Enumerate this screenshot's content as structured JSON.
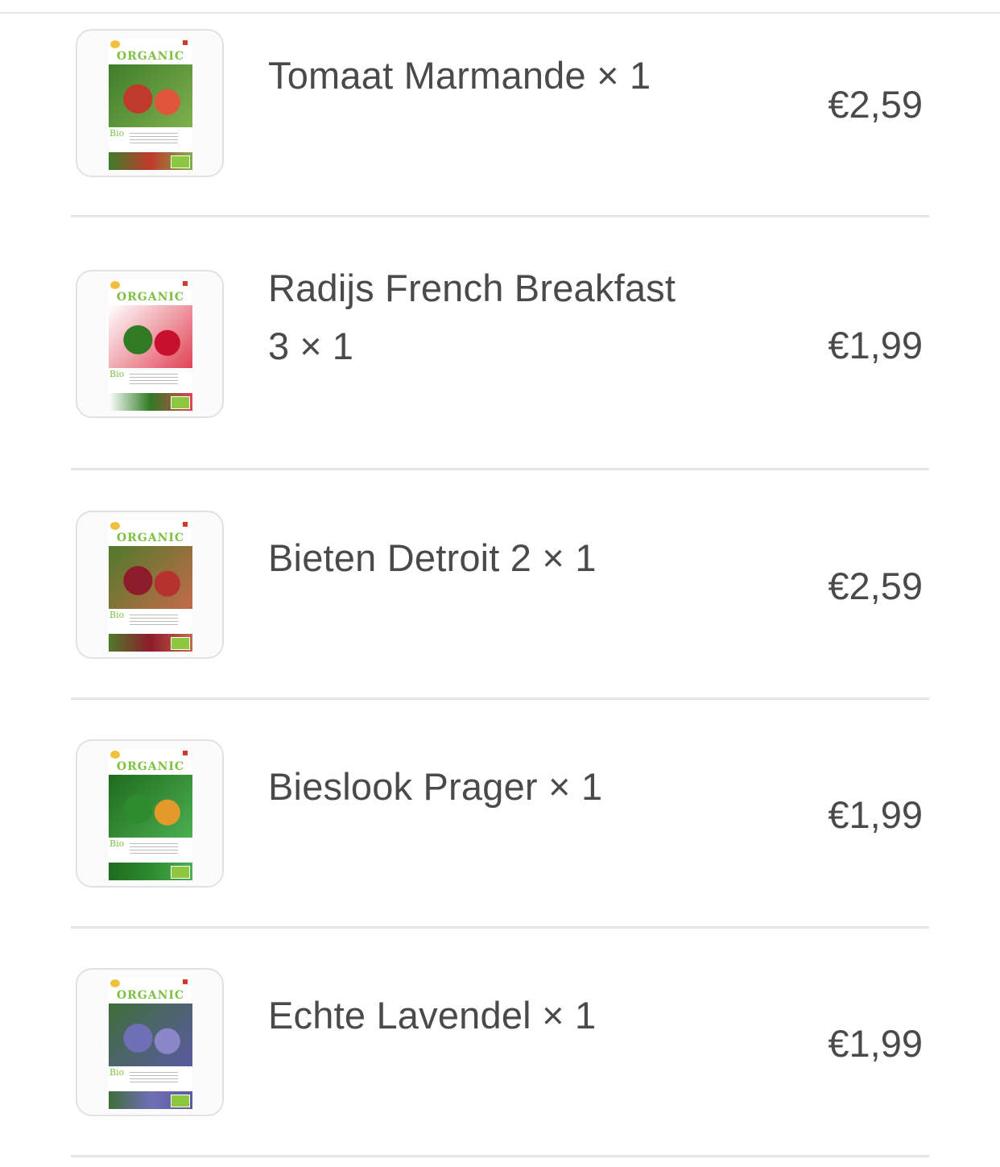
{
  "colors": {
    "text": "#4a4a4a",
    "divider": "#e5e5e7",
    "organic_green": "#7cc142"
  },
  "cart": {
    "items": [
      {
        "name": "Tomaat Marmande × 1",
        "name_line2": "",
        "price": "€2,59",
        "thumbnail": {
          "brand": "ORGANIC",
          "bio": "Bio",
          "photo_colors": [
            "#c0392b",
            "#e0553d",
            "#3f7d2a",
            "#7fb04e"
          ]
        }
      },
      {
        "name": "Radijs French Breakfast",
        "name_line2": "3 × 1",
        "price": "€1,99",
        "thumbnail": {
          "brand": "ORGANIC",
          "bio": "Bio",
          "photo_colors": [
            "#2f7a22",
            "#c8102e",
            "#ffffff",
            "#e04355"
          ]
        }
      },
      {
        "name": "Bieten Detroit 2 × 1",
        "name_line2": "",
        "price": "€2,59",
        "thumbnail": {
          "brand": "ORGANIC",
          "bio": "Bio",
          "photo_colors": [
            "#8e1b2a",
            "#b5322f",
            "#4f7a2a",
            "#c46a4b"
          ]
        }
      },
      {
        "name": "Bieslook Prager × 1",
        "name_line2": "",
        "price": "€1,99",
        "thumbnail": {
          "brand": "ORGANIC",
          "bio": "Bio",
          "photo_colors": [
            "#2e8b2e",
            "#e39a2a",
            "#1f6b1f",
            "#4caf50"
          ]
        }
      },
      {
        "name": "Echte Lavendel × 1",
        "name_line2": "",
        "price": "€1,99",
        "thumbnail": {
          "brand": "ORGANIC",
          "bio": "Bio",
          "photo_colors": [
            "#6f6fb6",
            "#8a86c8",
            "#3f6d3a",
            "#5a5aa0"
          ]
        }
      }
    ]
  }
}
